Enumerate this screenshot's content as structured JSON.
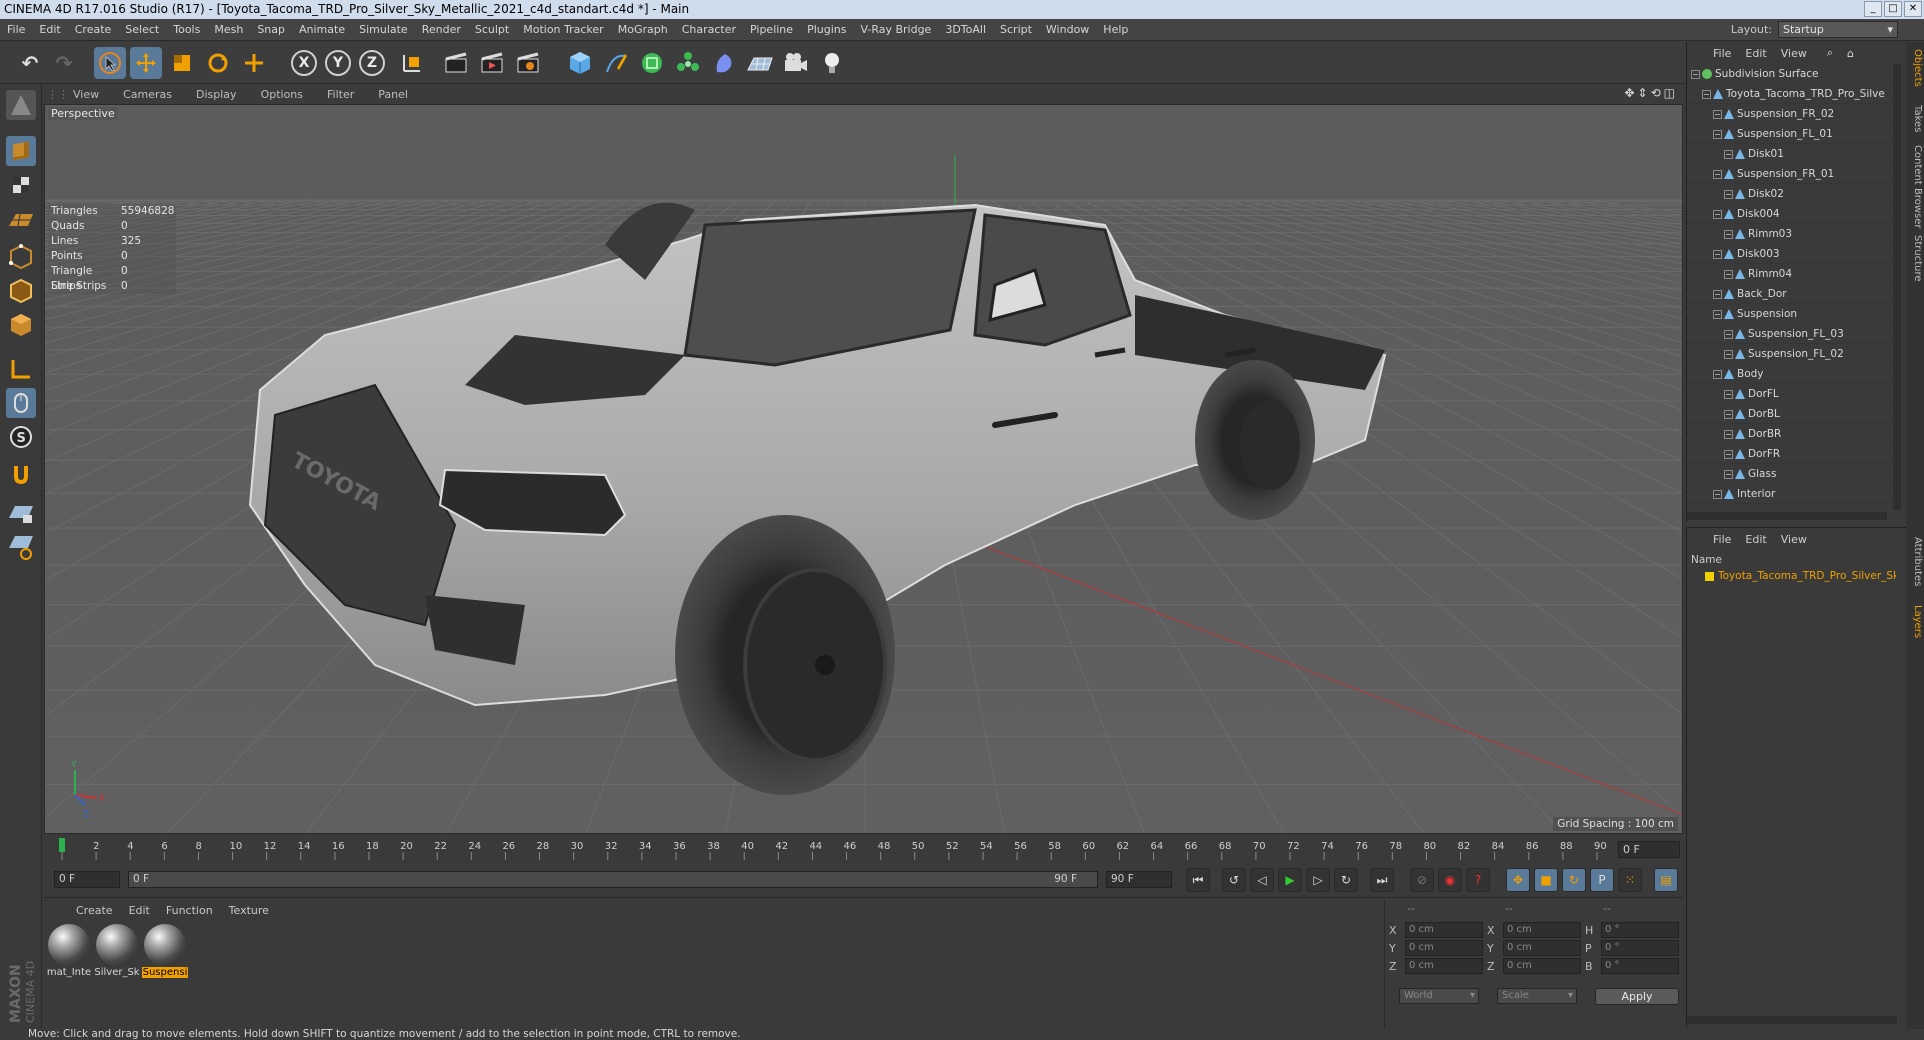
{
  "title": "CINEMA 4D R17.016 Studio (R17) - [Toyota_Tacoma_TRD_Pro_Silver_Sky_Metallic_2021_c4d_standart.c4d *] - Main",
  "menu": [
    "File",
    "Edit",
    "Create",
    "Select",
    "Tools",
    "Mesh",
    "Snap",
    "Animate",
    "Simulate",
    "Render",
    "Sculpt",
    "Motion Tracker",
    "MoGraph",
    "Character",
    "Pipeline",
    "Plugins",
    "V-Ray Bridge",
    "3DToAll",
    "Script",
    "Window",
    "Help"
  ],
  "layout": {
    "label": "Layout:",
    "value": "Startup"
  },
  "toolbar": {
    "axis_x": "X",
    "axis_y": "Y",
    "axis_z": "Z"
  },
  "viewport": {
    "menu": [
      "View",
      "Cameras",
      "Display",
      "Options",
      "Filter",
      "Panel"
    ],
    "camera": "Perspective",
    "stats": [
      {
        "label": "Triangles",
        "value": "55946828"
      },
      {
        "label": "Quads",
        "value": "0"
      },
      {
        "label": "Lines",
        "value": "325"
      },
      {
        "label": "Points",
        "value": "0"
      },
      {
        "label": "Triangle Strips",
        "value": "0"
      },
      {
        "label": "Line Strips",
        "value": "0"
      }
    ],
    "grid_spacing": "Grid Spacing : 100 cm",
    "axis_labels": {
      "y": "Y",
      "x": "X",
      "z": "Z"
    },
    "brand_text": "TOYOTA"
  },
  "timeline": {
    "ticks": [
      "0",
      "2",
      "4",
      "6",
      "8",
      "10",
      "12",
      "14",
      "16",
      "18",
      "20",
      "22",
      "24",
      "26",
      "28",
      "30",
      "32",
      "34",
      "36",
      "38",
      "40",
      "42",
      "44",
      "46",
      "48",
      "50",
      "52",
      "54",
      "56",
      "58",
      "60",
      "62",
      "64",
      "66",
      "68",
      "70",
      "72",
      "74",
      "76",
      "78",
      "80",
      "82",
      "84",
      "86",
      "88",
      "90"
    ],
    "current_frame": "0 F"
  },
  "transport": {
    "start": "0 F",
    "range_start": "0 F",
    "range_end": "90 F",
    "end": "90 F"
  },
  "materials": {
    "menu": [
      "Create",
      "Edit",
      "Function",
      "Texture"
    ],
    "items": [
      {
        "label": "mat_Inte",
        "selected": false
      },
      {
        "label": "Silver_Sk",
        "selected": false
      },
      {
        "label": "Suspensi",
        "selected": true
      }
    ]
  },
  "coordinates": {
    "headers": [
      "--",
      "--",
      "--"
    ],
    "rows": [
      {
        "a1": "X",
        "v1": "0 cm",
        "a2": "X",
        "v2": "0 cm",
        "a3": "H",
        "v3": "0 °"
      },
      {
        "a1": "Y",
        "v1": "0 cm",
        "a2": "Y",
        "v2": "0 cm",
        "a3": "P",
        "v3": "0 °"
      },
      {
        "a1": "Z",
        "v1": "0 cm",
        "a2": "Z",
        "v2": "0 cm",
        "a3": "B",
        "v3": "0 °"
      }
    ],
    "space": "World",
    "mode": "Scale",
    "apply": "Apply"
  },
  "objects": {
    "menu": [
      "File",
      "Edit",
      "View"
    ],
    "tree": [
      {
        "label": "Subdivision Surface",
        "depth": 0,
        "icon": "subdivision"
      },
      {
        "label": "Toyota_Tacoma_TRD_Pro_Silve",
        "depth": 1,
        "icon": "null"
      },
      {
        "label": "Suspension_FR_02",
        "depth": 2,
        "icon": "bone"
      },
      {
        "label": "Suspension_FL_01",
        "depth": 2,
        "icon": "bone"
      },
      {
        "label": "Disk01",
        "depth": 3,
        "icon": "bone"
      },
      {
        "label": "Suspension_FR_01",
        "depth": 2,
        "icon": "bone"
      },
      {
        "label": "Disk02",
        "depth": 3,
        "icon": "bone"
      },
      {
        "label": "Disk004",
        "depth": 2,
        "icon": "bone"
      },
      {
        "label": "Rimm03",
        "depth": 3,
        "icon": "bone"
      },
      {
        "label": "Disk003",
        "depth": 2,
        "icon": "bone"
      },
      {
        "label": "Rimm04",
        "depth": 3,
        "icon": "bone"
      },
      {
        "label": "Back_Dor",
        "depth": 2,
        "icon": "bone"
      },
      {
        "label": "Suspension",
        "depth": 2,
        "icon": "bone"
      },
      {
        "label": "Suspension_FL_03",
        "depth": 3,
        "icon": "bone"
      },
      {
        "label": "Suspension_FL_02",
        "depth": 3,
        "icon": "bone"
      },
      {
        "label": "Body",
        "depth": 2,
        "icon": "bone"
      },
      {
        "label": "DorFL",
        "depth": 3,
        "icon": "bone"
      },
      {
        "label": "DorBL",
        "depth": 3,
        "icon": "bone"
      },
      {
        "label": "DorBR",
        "depth": 3,
        "icon": "bone"
      },
      {
        "label": "DorFR",
        "depth": 3,
        "icon": "bone"
      },
      {
        "label": "Glass",
        "depth": 3,
        "icon": "bone"
      },
      {
        "label": "Interior",
        "depth": 2,
        "icon": "bone"
      }
    ]
  },
  "layers": {
    "menu": [
      "File",
      "Edit",
      "View"
    ],
    "name_header": "Name",
    "item": "Toyota_Tacoma_TRD_Pro_Silver_Sk"
  },
  "right_tabs": [
    "Objects",
    "Takes",
    "Content Browser",
    "Structure",
    "Attributes",
    "Layers"
  ],
  "brand": {
    "line1": "MAXON",
    "line2": "CINEMA 4D"
  },
  "status": "Move: Click and drag to move elements. Hold down SHIFT to quantize movement / add to the selection in point mode, CTRL to remove.",
  "colors": {
    "accent": "#f0a000",
    "selection": "#5a7a9a",
    "viewport_bg": "#5d5d5d"
  }
}
